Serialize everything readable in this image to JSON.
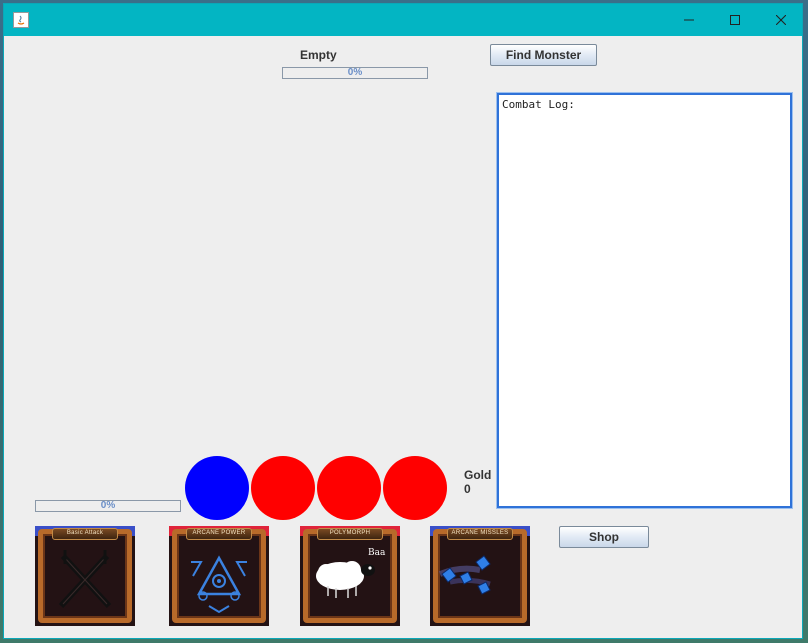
{
  "window": {
    "controls": [
      "minimize",
      "maximize",
      "close"
    ]
  },
  "monster": {
    "name": "Empty",
    "health_text": "0%",
    "health_fraction": 0
  },
  "find_monster_button": "Find Monster",
  "combat_log": {
    "text": "Combat Log:"
  },
  "player": {
    "health_text": "0%",
    "health_fraction": 0
  },
  "orbs": [
    {
      "color": "#0000ff"
    },
    {
      "color": "#ff0000"
    },
    {
      "color": "#ff0000"
    },
    {
      "color": "#ff0000"
    }
  ],
  "gold": {
    "label": "Gold",
    "value": "0"
  },
  "shop_button": "Shop",
  "abilities": [
    {
      "title": "Basic Attack",
      "icon": "crossed-swords-icon",
      "accent": "#3a4fc8"
    },
    {
      "title": "ARCANE POWER",
      "icon": "arcane-triangle-icon",
      "accent": "#e0243a"
    },
    {
      "title": "POLYMORPH",
      "icon": "sheep-icon",
      "accent": "#e0243a",
      "caption": "Baa"
    },
    {
      "title": "ARCANE MISSLES",
      "icon": "arcane-missiles-icon",
      "accent": "#3a4fc8"
    }
  ]
}
